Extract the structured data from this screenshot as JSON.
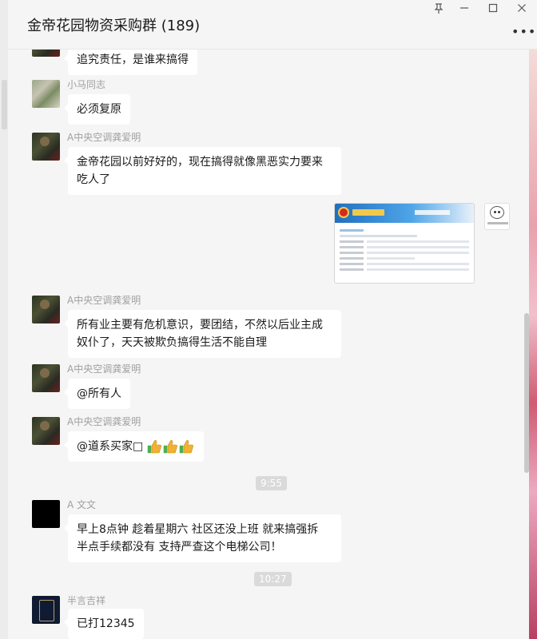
{
  "window": {
    "title": "金帝花园物资采购群 (189)",
    "controls": {
      "pin": "pin-icon",
      "minimize": "minimize-icon",
      "maximize": "maximize-icon",
      "close": "close-icon"
    },
    "more_label": "•••"
  },
  "messages": [
    {
      "sender": "",
      "text": "追究责任，是谁来搞得"
    },
    {
      "sender": "小马同志",
      "text": "必须复原"
    },
    {
      "sender": "A中央空调龚爱明",
      "text": "金帝花园以前好好的，现在搞得就像黑恶实力要来吃人了"
    },
    {
      "sender": "A中央空调龚爱明",
      "text": "所有业主要有危机意识，要团结，不然以后业主成奴仆了，天天被欺负搞得生活不能自理"
    },
    {
      "sender": "A中央空调龚爱明",
      "text": "@所有人"
    },
    {
      "sender": "A中央空调龚爱明",
      "text": "@道系买家□"
    },
    {
      "sender": "A 文文",
      "text": "早上8点钟 趁着星期六  社区还没上班 就来搞强拆 半点手续都没有 支持严查这个电梯公司！"
    },
    {
      "sender": "半言吉祥",
      "text": "已打12345"
    }
  ],
  "timestamps": [
    "9:55",
    "10:27"
  ],
  "icons": {
    "thumbs_up": "thumbs-up-icon",
    "image": "screenshot-image",
    "sticker": "sticker-image"
  },
  "colors": {
    "bubble": "#ffffff",
    "background": "#f5f5f5",
    "sender": "#a0a0a0",
    "time_bg": "#dadada"
  }
}
